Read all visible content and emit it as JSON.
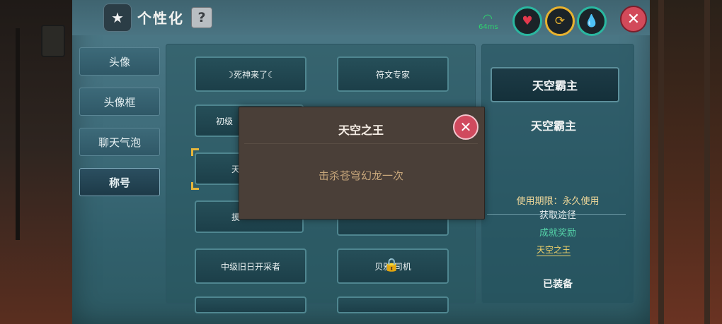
{
  "header": {
    "title": "个性化",
    "help_label": "?"
  },
  "status": {
    "ping": "64ms"
  },
  "icons": {
    "star": "★",
    "heart": "♥",
    "swap": "⟳",
    "drop": "💧",
    "close": "✕",
    "lock": "🔒"
  },
  "sidebar": {
    "items": [
      {
        "label": "头像"
      },
      {
        "label": "头像框"
      },
      {
        "label": "聊天气泡"
      },
      {
        "label": "称号"
      }
    ],
    "active_index": 3
  },
  "titles_grid": {
    "items": [
      {
        "label": "☽死神来了☾"
      },
      {
        "label": "符文专家"
      },
      {
        "label": "初级"
      },
      {
        "label": "天"
      },
      {
        "label": "摸"
      },
      {
        "label": "中级旧日开采者"
      },
      {
        "label": "贝雅 司机"
      }
    ]
  },
  "detail": {
    "title_button": "天空霸主",
    "title_name": "天空霸主",
    "period": "使用期限：永久使用",
    "source_label": "获取途径",
    "source_type": "成就奖励",
    "source_link": "天空之王",
    "state": "已装备"
  },
  "popup": {
    "title": "天空之王",
    "description": "击杀苍穹幻龙一次"
  },
  "colors": {
    "accent_gold": "#e7b63a",
    "source_green": "#55d3a8",
    "close_red": "#d24a5a"
  }
}
